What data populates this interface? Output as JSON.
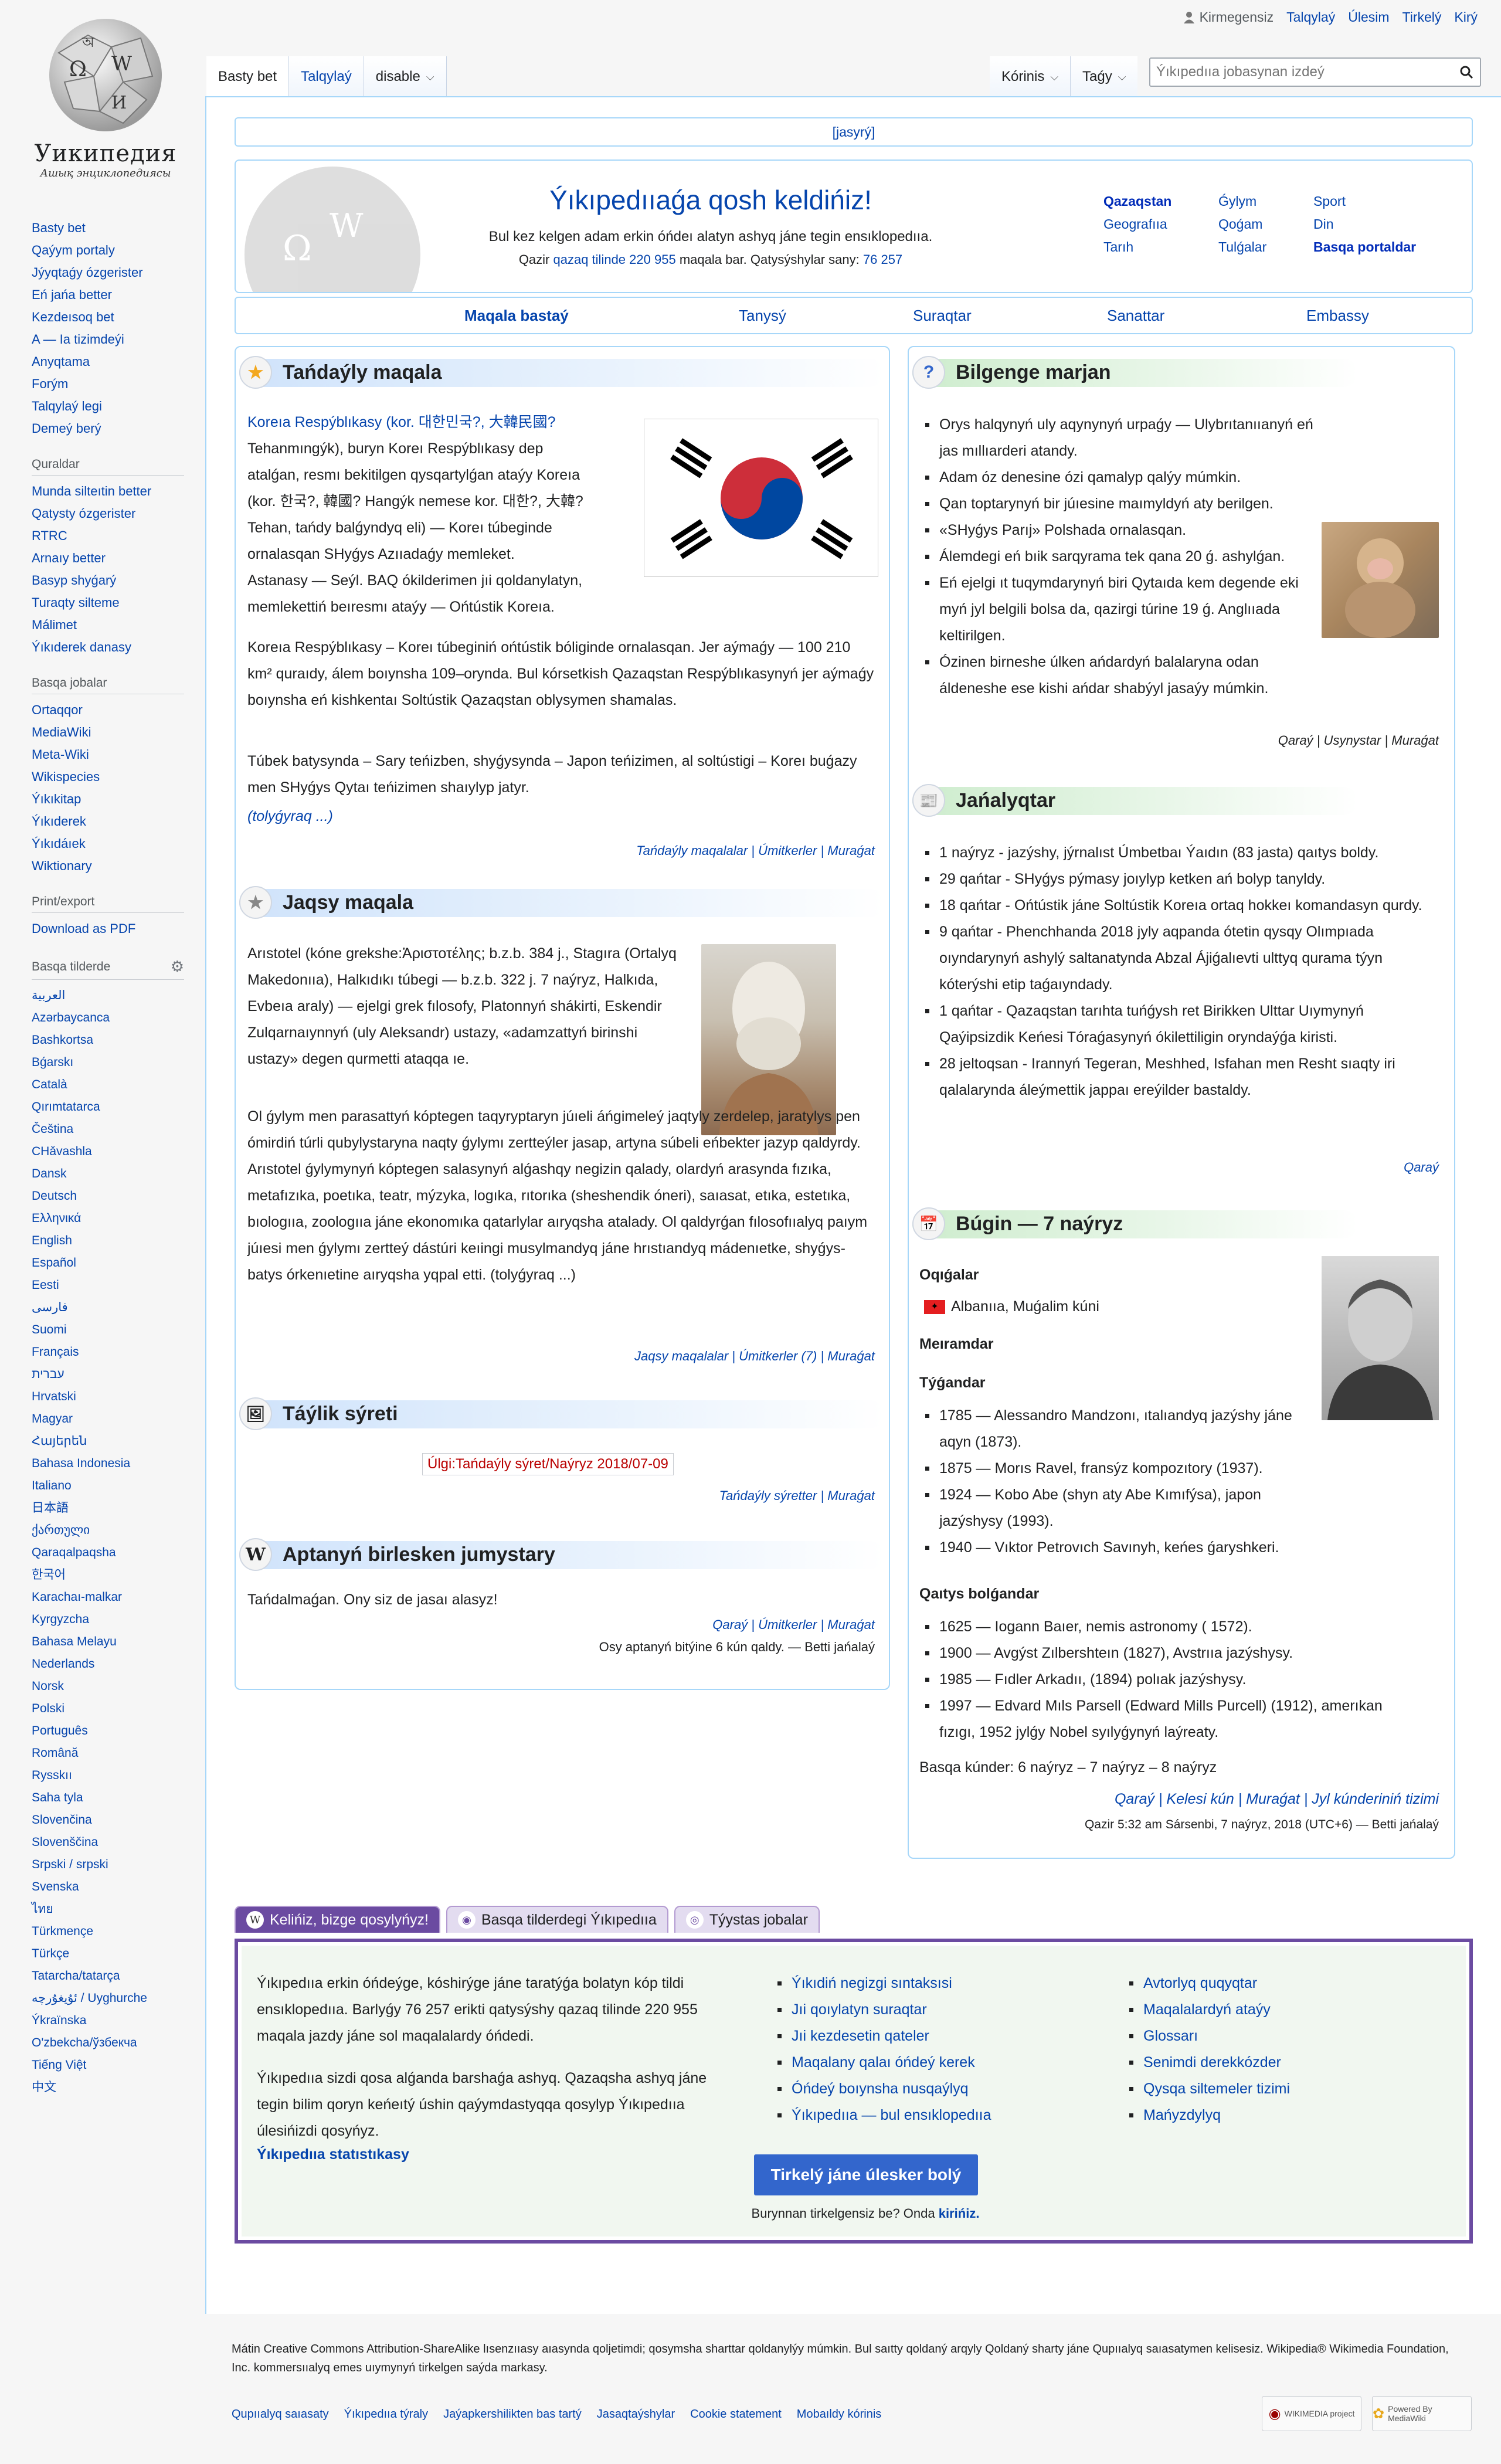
{
  "logo": {
    "title": "Уикипедия",
    "subtitle": "Ашық энциклопедиясы"
  },
  "personal": [
    "Kirmegensiz",
    "Talqylaý",
    "Úlesim",
    "Tirkelý",
    "Kirý"
  ],
  "tabs_left": [
    "Basty bet",
    "Talqylaý",
    "disable"
  ],
  "tabs_right": [
    "Kórinis",
    "Taǵy"
  ],
  "search": {
    "placeholder": "Ýıkıpedııa jobasynan izdeý"
  },
  "sidebar": {
    "nav": [
      "Basty bet",
      "Qaýym portaly",
      "Jýyqtaǵy ózgerister",
      "Eń jańa better",
      "Kezdeısoq bet",
      "A — Ia tizimdeýi",
      "Anyqtama",
      "Forým",
      "Talqylaý legi",
      "Demeý berý"
    ],
    "tools_title": "Quraldar",
    "tools": [
      "Munda silteıtin better",
      "Qatysty ózgerister",
      "RTRC",
      "Arnaıy better",
      "Basyp shyǵarý",
      "Turaqty silteme",
      "Málimet",
      "Ýıkıderek danasy"
    ],
    "other_title": "Basqa jobalar",
    "other": [
      "Ortaqqor",
      "MediaWiki",
      "Meta-Wiki",
      "Wikispecies",
      "Ýıkıkitap",
      "Ýıkıderek",
      "Ýıkıdáıek",
      "Wiktionary"
    ],
    "print_title": "Print/export",
    "print": [
      "Download as PDF"
    ],
    "lang_title": "Basqa tilderde",
    "langs": [
      "العربية",
      "Azərbaycanca",
      "Bashkortsa",
      "Bǵarskı",
      "Català",
      "Qırımtatarca",
      "Čeština",
      "CHǎvashla",
      "Dansk",
      "Deutsch",
      "Ελληνικά",
      "English",
      "Español",
      "Eesti",
      "فارسی",
      "Suomi",
      "Français",
      "עברית",
      "Hrvatski",
      "Magyar",
      "Հայերեն",
      "Bahasa Indonesia",
      "Italiano",
      "日本語",
      "ქართული",
      "Qaraqalpaqsha",
      "한국어",
      "Karachaı-malkar",
      "Kyrgyzcha",
      "Bahasa Melayu",
      "Nederlands",
      "Norsk",
      "Polski",
      "Português",
      "Română",
      "Rysskıı",
      "Saha tyla",
      "Slovenčina",
      "Slovenščina",
      "Srpski / srpski",
      "Svenska",
      "ไทย",
      "Türkmençe",
      "Türkçe",
      "Tatarcha/tatarça",
      "ئۇيغۇرچە / Uyghurche",
      "Ýkraïnska",
      "O'zbekcha/ўзбекча",
      "Tiếng Việt",
      "中文"
    ]
  },
  "hide_label": "[jasyrý]",
  "welcome": {
    "title": "Ýıkıpedııaǵa qosh keldińiz!",
    "line1": "Bul kez kelgen adam erkin óńdeı alatyn ashyq jáne tegin ensıklopedııa.",
    "line2_pre": "Qazir",
    "line2_link": "qazaq tilinde",
    "line2_count": "220 955",
    "line2_mid": "maqala bar. Qatysýshylar sany:",
    "line2_users": "76 257"
  },
  "portals": [
    "Qazaqstan",
    "Ǵylym",
    "Sport",
    "Geografııa",
    "Qoǵam",
    "Din",
    "Tarıh",
    "Tulǵalar",
    "Basqa portaldar"
  ],
  "topnav": [
    "Maqala bastaý",
    "Tanysý",
    "Suraqtar",
    "Sanattar",
    "Embassy"
  ],
  "featured": {
    "title": "Tańdaýly maqala",
    "p1_a": "Koreıa Respýblıkasy (kor. 대한민국?, 大韓民國?",
    "p1_b": "Tehanmıngýk), buryn Koreı Respýblıkasy dep",
    "p1_c": "atalǵan, resmı bekitilgen qysqartylǵan ataýy Koreıa",
    "p1_d": "(kor. 한국?, 韓國? Hangýk nemese kor. 대한?, 大韓?",
    "p1_e": "Tehan, tańdy balǵyndyq eli) — Koreı túbeginde",
    "p1_f": "ornalasqan SHyǵys Azııadaǵy memleket.",
    "p1_g": "Astanasy — Seýl. BAQ ókilderimen jıi qoldanylatyn,",
    "p1_h": "memlekettiń beıresmı ataýy — Ońtústik Koreıa.",
    "p2": "Koreıa Respýblıkasy – Koreı túbeginiń ońtústik bóliginde ornalasqan. Jer aýmaǵy — 100 210 km² quraıdy, álem boıynsha 109–orynda. Bul kórsetkish Qazaqstan Respýblıkasynyń jer aýmaǵy boıynsha eń kishkentaı Soltústik Qazaqstan oblysymen shamalas.",
    "p3": "Túbek batysynda – Sary teńizben, shyǵysynda – Japon teńizimen, al soltústigi – Koreı buǵazy men SHyǵys Qytaı teńizimen shaıylyp jatyr.",
    "more": "(tolyǵyraq ...)",
    "footer": "Tańdaýly maqalalar | Úmitkerler | Muraǵat"
  },
  "good": {
    "title": "Jaqsy maqala",
    "p1": "Arıstotel (kóne grekshe:Ἀριστοτέλης; b.z.b. 384 j., Stagıra (Ortalyq Makedonııa), Halkıdıkı túbegi — b.z.b. 322 j. 7 naýryz, Halkıda, Evbeıa araly) — ejelgi grek fılosofy, Platonnyń shákirti, Eskendir Zulqarnaıynnyń (uly Aleksandr) ustazy, «adamzattyń birinshi ustazy» degen qurmetti ataqqa ıe.",
    "p2": "Ol ǵylym men parasattyń kóptegen taqyryptaryn júıeli áńgimeleý jaqtyly zerdelep, jaratylys pen ómirdiń túrli qubylystaryna naqty ǵylymı zertteýler jasap, artyna súbeli eńbekter jazyp qaldyrdy. Arıstotel ǵylymynyń kóptegen salasynyń alǵashqy negizin qalady, olardyń arasynda fızıka, metafızıka, poetıka, teatr, mýzyka, logıka, rıtorıka (sheshendik óneri), saıasat, etıka, estetıka, bıologııa, zoologııa jáne ekonomıka qatarlylar aıryqsha atalady. Ol qaldyrǵan fılosofııalyq paıym júıesi men ǵylymı zertteý dástúri keıingi musylmandyq jáne hrıstıandyq mádenıetke, shyǵys-batys órkenıetine aıryqsha yqpal etti. (tolyǵyraq ...)",
    "footer": "Jaqsy maqalalar | Úmitkerler (7) | Muraǵat"
  },
  "picture": {
    "title": "Táýlik sýreti",
    "template": "Úlgi:Tańdaýly sýret/Naýryz 2018/07-09",
    "footer": "Tańdaýly sýretter | Muraǵat"
  },
  "collab": {
    "title": "Aptanyń birlesken jumystary",
    "text": "Tańdalmaǵan. Ony siz de jasaı alasyz!",
    "footer": "Qaraý | Úmitkerler | Muraǵat",
    "note": "Osy aptanyń bitýine 6 kún qaldy. — Betti jańalaý"
  },
  "dyk": {
    "title": "Bilgenge marjan",
    "items": [
      "Orys halqynyń uly aqynynyń urpaǵy — Ulybrıtanııanyń eń jas mıllıarderi atandy.",
      "Adam óz denesine ózi qamalyp qalýy múmkin.",
      "Qan toptarynyń bir júıesine maımyldyń aty berilgen.",
      "«SHyǵys Parıj» Polshada ornalasqan.",
      "Álemdegi eń bıik sarqyrama tek qana 20 ǵ. ashylǵan.",
      "Eń ejelgi ıt tuqymdarynyń biri Qytaıda kem degende eki myń jyl belgili bolsa da, qazirgi túrine 19 ǵ. Anglııada keltirilgen.",
      "Ózinen birneshe úlken ańdardyń balalaryna odan áldeneshe ese kishi ańdar shabýyl jasaýy múmkin."
    ],
    "footer": "Qaraý | Usynystar | Muraǵat"
  },
  "news": {
    "title": "Jańalyqtar",
    "items": [
      "1 naýryz - jazýshy, jýrnalıst Úmbetbaı Ýaıdın (83 jasta) qaıtys boldy.",
      "29 qańtar - SHyǵys pýmasy joıylyp ketken ań bolyp tanyldy.",
      "18 qańtar - Ońtústik jáne Soltústik Koreıa ortaq hokkeı komandasyn qurdy.",
      "9 qańtar - Phenchhanda 2018 jyly aqpanda ótetin qysqy Olımpıada oıyndarynyń ashylý saltanatynda Abzal Ájiǵalıevti ulttyq qurama týyn kóterýshi etip taǵaıyndady.",
      "1 qańtar - Qazaqstan tarıhta tuńǵysh ret Birikken Ulttar Uıymynyń Qaýipsizdik Keńesi Tóraǵasynyń ókilettiligin oryndaýǵa kiristi.",
      "28 jeltoqsan - Irannyń Tegeran, Meshhed, Isfahan men Resht sıaqty iri qalalarynda áleýmettik jappaı ereýilder bastaldy."
    ],
    "footer": "Qaraý"
  },
  "today": {
    "title": "Búgin — 7 naýryz",
    "holidays_h": "Oqıǵalar",
    "holiday": "Albanııa, Muǵalim kúni",
    "celebs_h": "Meıramdar",
    "births_h": "Týǵandar",
    "births": [
      "1785 — Alessandro Mandzonı, ıtalıandyq jazýshy jáne aqyn (1873).",
      "1875 — Morıs Ravel, fransýz kompozıtory (1937).",
      "1924 — Kobo Abe (shyn aty Abe Kımıfýsa), japon jazýshysy (1993).",
      "1940 — Vıktor Petrovıch Savınyh, keńes ǵaryshkeri."
    ],
    "deaths_h": "Qaıtys bolǵandar",
    "deaths": [
      "1625 — Iogann Baıer, nemis astronomy ( 1572).",
      "1900 — Avgýst Zılbershteın (1827), Avstrııa jazýshysy.",
      "1985 — Fıdler Arkadıı, (1894) polıak jazýshysy.",
      "1997 — Edvard Mıls Parsell (Edward Mills Purcell) (1912), amerıkan fızıgı, 1952 jylǵy Nobel syılyǵynyń laýreaty."
    ],
    "other": "Basqa kúnder: 6 naýryz – 7 naýryz – 8 naýryz",
    "footer": "Qaraý | Kelesi kún | Muraǵat | Jyl kúnderiniń tizimi",
    "time": "Qazir 5:32 am Sársenbi, 7 naýryz, 2018 (UTC+6) — Betti jańalaý"
  },
  "bottom_tabs": [
    "Kelińiz, bizge qosylyńyz!",
    "Basqa tilderdegi Ýıkıpedııa",
    "Týystas jobalar"
  ],
  "join": {
    "p1": "Ýıkıpedııa erkin óńdeýge, kóshirýge jáne taratýǵa bolatyn kóp tildi ensıklopedııa. Barlyǵy 76 257 erikti qatysýshy qazaq tilinde 220 955 maqala jazdy jáne sol maqalalardy óńdedi.",
    "p2": "Ýıkıpedııa sizdi qosa alǵanda barshaǵa ashyq. Qazaqsha ashyq jáne tegin bilim qoryn keńeıtý úshin qaýymdastyqqa qosylyp Ýıkıpedııa úlesińizdi qosyńyz.",
    "stats": "Ýıkıpedııa statıstıkasy",
    "col1": [
      "Ýıkıdiń negizgi sıntaksısi",
      "Jıi qoıylatyn suraqtar",
      "Jıi kezdesetin qateler",
      "Maqalany qalaı óńdeý kerek",
      "Óńdeý boıynsha nusqaýlyq",
      "Ýıkıpedııa — bul ensıklopedııa"
    ],
    "col2": [
      "Avtorlyq quqyqtar",
      "Maqalalardyń ataýy",
      "Glossarı",
      "Senimdi derekkózder",
      "Qysqa siltemeler tizimi",
      "Mańyzdylyq"
    ],
    "button": "Tirkelý jáne úlesker bolý",
    "signin_pre": "Burynnan tirkelgensiz be? Onda",
    "signin_link": "kirińiz."
  },
  "footer": {
    "license": "Mátin Creative Commons Attribution-ShareAlike lısenzııasy aıasynda qoljetimdi; qosymsha sharttar qoldanylýy múmkin. Bul saıtty qoldaný arqyly Qoldaný sharty jáne Qupııalyq saıasatymen kelisesiz. Wikipedia® Wikimedia Foundation, Inc. kommersııalyq emes uıymynyń tirkelgen saýda markasy.",
    "links": [
      "Qupııalyq saıasaty",
      "Ýıkıpedııa týraly",
      "Jaýapkershilikten bas tartý",
      "Jasaqtaýshylar",
      "Cookie statement",
      "Mobaıldy kórinis"
    ],
    "badge1": "WIKIMEDIA project",
    "badge2": "Powered By MediaWiki"
  },
  "colors": {
    "link": "#0645ad",
    "border": "#a7d7f9",
    "purple": "#6b4ba1"
  }
}
